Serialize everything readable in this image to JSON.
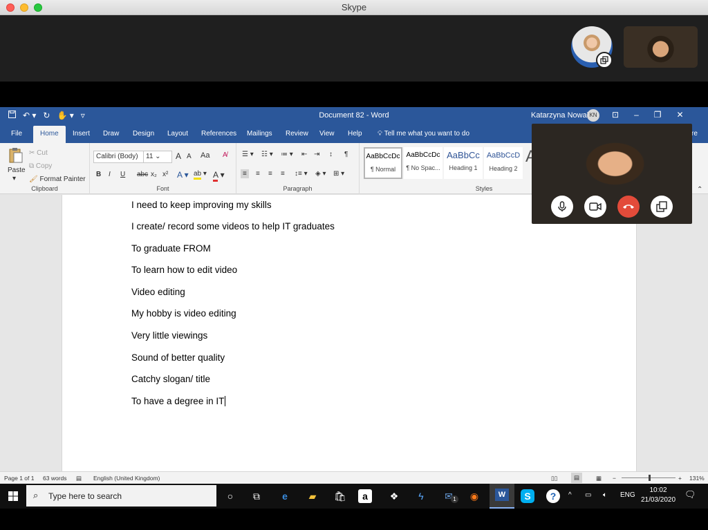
{
  "mac": {
    "title": "Skype"
  },
  "word": {
    "qat_icons": [
      "save-icon",
      "undo-icon",
      "redo-icon",
      "touch-mode-icon",
      "customize-icon"
    ],
    "doc_title": "Document 82  -  Word",
    "user_name": "Katarzyna Nowak",
    "user_initials": "KN",
    "tabs": [
      "File",
      "Home",
      "Insert",
      "Draw",
      "Design",
      "Layout",
      "References",
      "Mailings",
      "Review",
      "View",
      "Help"
    ],
    "tell_me": "Tell me what you want to do",
    "share_fragment": "re",
    "clipboard": {
      "paste": "Paste",
      "cut": "Cut",
      "copy": "Copy",
      "format_painter": "Format Painter",
      "label": "Clipboard"
    },
    "font": {
      "name": "Calibri (Body)",
      "size": "11",
      "label": "Font",
      "bold": "B",
      "italic": "I",
      "underline": "U",
      "strike": "abc",
      "sub": "x₂",
      "sup": "x²",
      "case": "Aa",
      "grow": "A",
      "shrink": "A"
    },
    "paragraph": {
      "label": "Paragraph"
    },
    "styles": {
      "label": "Styles",
      "items": [
        {
          "sample": "AaBbCcDc",
          "name": "¶ Normal"
        },
        {
          "sample": "AaBbCcDc",
          "name": "¶ No Spac..."
        },
        {
          "sample": "AaBbCc",
          "name": "Heading 1"
        },
        {
          "sample": "AaBbCcD",
          "name": "Heading 2"
        }
      ],
      "more": "A"
    },
    "paragraphs": [
      "I need to keep improving my skills",
      "I create/ record some videos to help IT graduates",
      "To graduate FROM",
      "To learn how to edit video",
      "Video editing",
      "My hobby is video editing",
      "Very little viewings",
      "Sound of better quality",
      "Catchy slogan/ title",
      "To have a degree in IT"
    ],
    "status": {
      "page": "Page 1 of 1",
      "words": "63 words",
      "language": "English (United Kingdom)",
      "zoom_minus": "−",
      "zoom_plus": "+",
      "zoom": "131%"
    }
  },
  "call": {
    "buttons": [
      "microphone-icon",
      "camera-icon",
      "end-call-icon",
      "pop-out-icon"
    ],
    "end_color": "#e34b3a"
  },
  "taskbar": {
    "search_placeholder": "Type here to search",
    "tray_lang": "ENG",
    "time": "10:02",
    "date": "21/03/2020",
    "mail_badge": "1"
  }
}
